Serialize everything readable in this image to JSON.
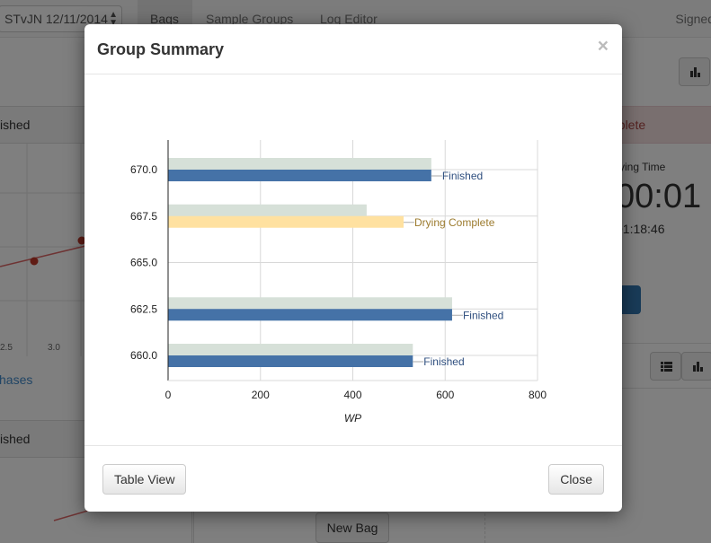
{
  "background": {
    "nav": {
      "bag_select": "STvJN 12/11/2014",
      "items": [
        "Bags",
        "Sample Groups",
        "Log Editor"
      ],
      "signed": "Signed"
    },
    "left": {
      "panel1_status": "ished",
      "panel2_status": "ished",
      "phases_link": "hases",
      "axis_ticks": [
        "2.5",
        "3.0"
      ]
    },
    "right": {
      "status": "nplete",
      "drying_label": "rying Time",
      "timer_large": "00:01",
      "timer_small": "01:18:46",
      "start_button": "rt"
    },
    "new_bag_button": "New Bag"
  },
  "modal": {
    "title": "Group Summary",
    "close_symbol": "×",
    "table_view_button": "Table View",
    "close_button": "Close"
  },
  "chart_data": {
    "type": "bar",
    "orientation": "horizontal",
    "xlabel": "WP",
    "xlim": [
      0,
      800
    ],
    "xticks": [
      "0",
      "200",
      "400",
      "600",
      "800"
    ],
    "ylim": [
      659,
      671
    ],
    "yticks": [
      "660.0",
      "662.5",
      "665.0",
      "667.5",
      "670.0"
    ],
    "grid": true,
    "bars": [
      {
        "y": 670.0,
        "value": 570,
        "reference": 570,
        "label": "Finished",
        "color": "#4572a7",
        "label_color": "#2f4f7f"
      },
      {
        "y": 667.5,
        "value": 510,
        "reference": 430,
        "label": "Drying Complete",
        "color": "#ffe1a0",
        "label_color": "#9c7b2e"
      },
      {
        "y": 662.5,
        "value": 615,
        "reference": 615,
        "label": "Finished",
        "color": "#4572a7",
        "label_color": "#2f4f7f"
      },
      {
        "y": 660.0,
        "value": 530,
        "reference": 530,
        "label": "Finished",
        "color": "#4572a7",
        "label_color": "#2f4f7f"
      }
    ],
    "reference_color": "#d6e0d8"
  }
}
